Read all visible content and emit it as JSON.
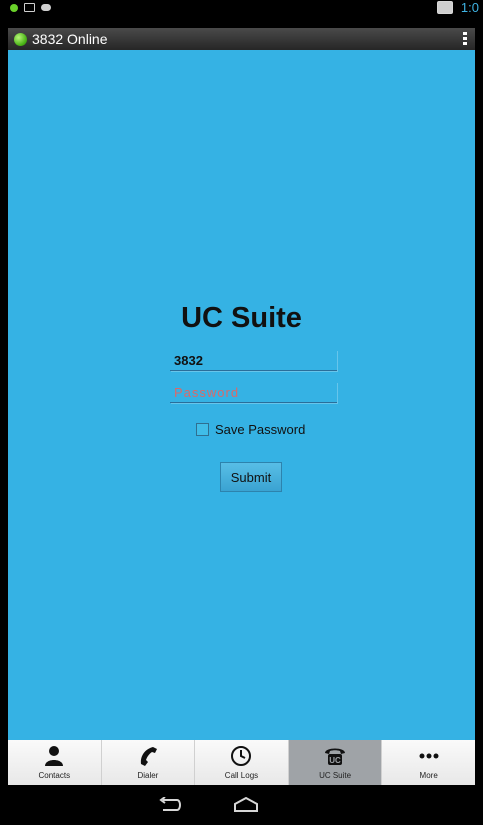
{
  "status_bar": {
    "time": "1:0",
    "icons": [
      "notification-dot-icon",
      "voicemail-icon",
      "message-icon",
      "tablet-icon"
    ]
  },
  "header": {
    "status_text": "3832 Online",
    "status_color": "#48b315",
    "menu_icon": "overflow-menu-icon"
  },
  "login": {
    "title": "UC Suite",
    "username": "3832",
    "password_placeholder": "Password",
    "save_password_label": "Save Password",
    "save_password_checked": false,
    "submit_label": "Submit"
  },
  "tabs": [
    {
      "label": "Contacts",
      "icon": "contacts-icon",
      "active": false
    },
    {
      "label": "Dialer",
      "icon": "phone-handset-icon",
      "active": false
    },
    {
      "label": "Call Logs",
      "icon": "clock-icon",
      "active": false
    },
    {
      "label": "UC Suite",
      "icon": "uc-phone-icon",
      "active": true
    },
    {
      "label": "More",
      "icon": "more-dots-icon",
      "active": false
    }
  ],
  "nav": {
    "back_icon": "back-icon",
    "home_icon": "home-icon"
  },
  "colors": {
    "background": "#35b2e4",
    "accent": "#3fb3e3",
    "active_tab": "#9fa3a7"
  }
}
